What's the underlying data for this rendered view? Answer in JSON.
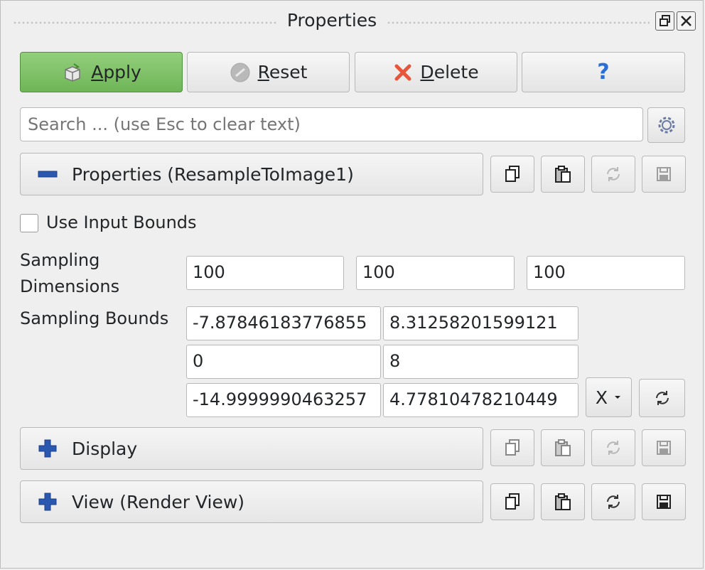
{
  "window": {
    "title": "Properties"
  },
  "toolbar": {
    "apply_label": "Apply",
    "apply_mnemonic": "A",
    "apply_rest": "pply",
    "reset_label": "Reset",
    "reset_mnemonic": "R",
    "reset_rest": "eset",
    "delete_label": "Delete",
    "delete_mnemonic": "D",
    "delete_rest": "elete",
    "help_label": "?"
  },
  "search": {
    "placeholder": "Search ... (use Esc to clear text)"
  },
  "sections": {
    "properties": {
      "label": "Properties (ResampleToImage1)",
      "expanded": true
    },
    "display": {
      "label": "Display",
      "expanded": false
    },
    "view": {
      "label": "View (Render View)",
      "expanded": false
    }
  },
  "options": {
    "use_input_bounds_label": "Use Input Bounds",
    "use_input_bounds_checked": false,
    "sampling_dimensions_label_line1": "Sampling",
    "sampling_dimensions_label_line2": "Dimensions",
    "sampling_dimensions": [
      "100",
      "100",
      "100"
    ],
    "sampling_bounds_label": "Sampling Bounds",
    "sampling_bounds": [
      [
        "-7.87846183776855",
        "8.31258201599121"
      ],
      [
        "0",
        "8"
      ],
      [
        "-14.9999990463257",
        "4.77810478210449"
      ]
    ],
    "axis_menu_value": "X"
  },
  "colors": {
    "accent_green": "#7cc163",
    "icon_blue": "#2a58b0",
    "delete_red": "#e8553a"
  }
}
